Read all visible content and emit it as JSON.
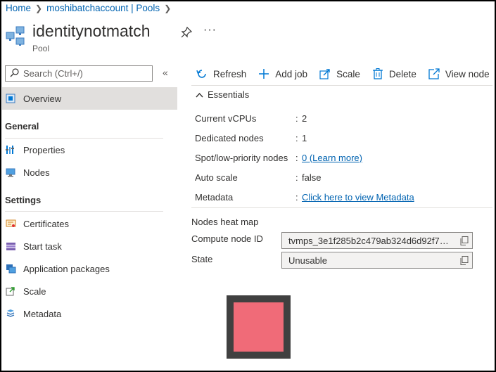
{
  "breadcrumb": {
    "home": "Home",
    "account": "moshibatchaccount | Pools"
  },
  "header": {
    "title": "identitynotmatch",
    "subtitle": "Pool"
  },
  "sidebar": {
    "search_placeholder": "Search (Ctrl+/)",
    "overview": "Overview",
    "general_heading": "General",
    "general_items": [
      "Properties",
      "Nodes"
    ],
    "settings_heading": "Settings",
    "settings_items": [
      "Certificates",
      "Start task",
      "Application packages",
      "Scale",
      "Metadata"
    ]
  },
  "toolbar": {
    "refresh": "Refresh",
    "add_job": "Add job",
    "scale": "Scale",
    "delete": "Delete",
    "view_node": "View node"
  },
  "essentials": {
    "toggle_label": "Essentials",
    "rows": [
      {
        "label": "Current vCPUs",
        "value": "2"
      },
      {
        "label": "Dedicated nodes",
        "value": "1"
      },
      {
        "label": "Spot/low-priority nodes",
        "value": "0 (Learn more)"
      },
      {
        "label": "Auto scale",
        "value": "false"
      },
      {
        "label": "Metadata",
        "value": "Click here to view Metadata"
      }
    ]
  },
  "node": {
    "heatmap_label": "Nodes heat map",
    "compute_node_id_label": "Compute node ID",
    "compute_node_id": "tvmps_3e1f285b2c479ab324d6d92f794...",
    "state_label": "State",
    "state": "Unusable",
    "heat_color": "#f06b78"
  },
  "colors": {
    "link": "#0063b1",
    "accent_blue": "#0078d4",
    "active_nav": "#e1dfdd"
  }
}
